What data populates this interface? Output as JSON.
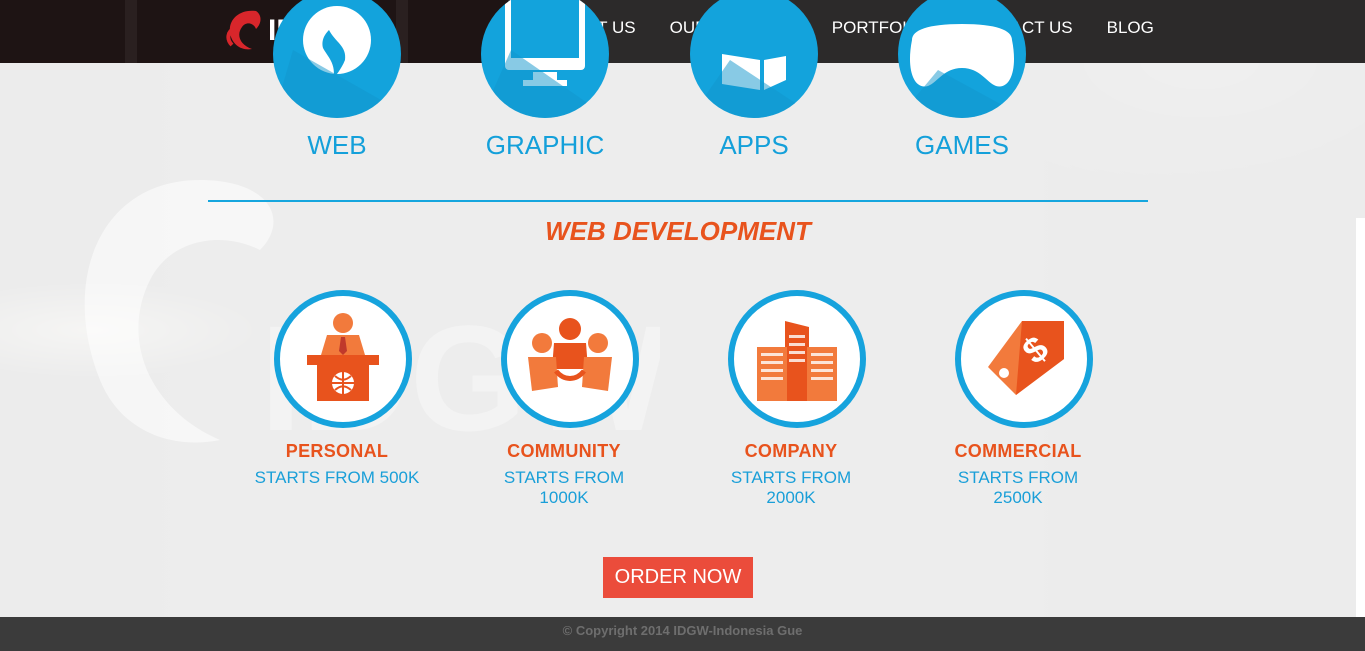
{
  "header": {
    "logo_text": "IDGW",
    "nav": [
      "ABOUT US",
      "OUR SERVICES",
      "PORTFOLIO",
      "CONTACT US",
      "BLOG"
    ]
  },
  "categories": [
    {
      "label": "WEB",
      "icon": "globe-icon"
    },
    {
      "label": "GRAPHIC",
      "icon": "monitor-icon"
    },
    {
      "label": "APPS",
      "icon": "windows-icon"
    },
    {
      "label": "GAMES",
      "icon": "gamepad-icon"
    }
  ],
  "section": {
    "title": "WEB DEVELOPMENT"
  },
  "packages": [
    {
      "name": "PERSONAL",
      "price": "STARTS FROM 500K",
      "icon": "speaker-podium-icon"
    },
    {
      "name": "COMMUNITY",
      "price": "STARTS FROM 1000K",
      "icon": "people-group-icon"
    },
    {
      "name": "COMPANY",
      "price": "STARTS FROM 2000K",
      "icon": "buildings-icon"
    },
    {
      "name": "COMMERCIAL",
      "price": "STARTS FROM 2500K",
      "icon": "price-tag-icon"
    }
  ],
  "cta": {
    "label": "ORDER NOW"
  },
  "footer": {
    "copyright": "© Copyright 2014 IDGW-Indonesia Gue"
  },
  "colors": {
    "accent_blue": "#13a3dc",
    "accent_orange": "#e8531d",
    "button_red": "#eb4c3b"
  }
}
